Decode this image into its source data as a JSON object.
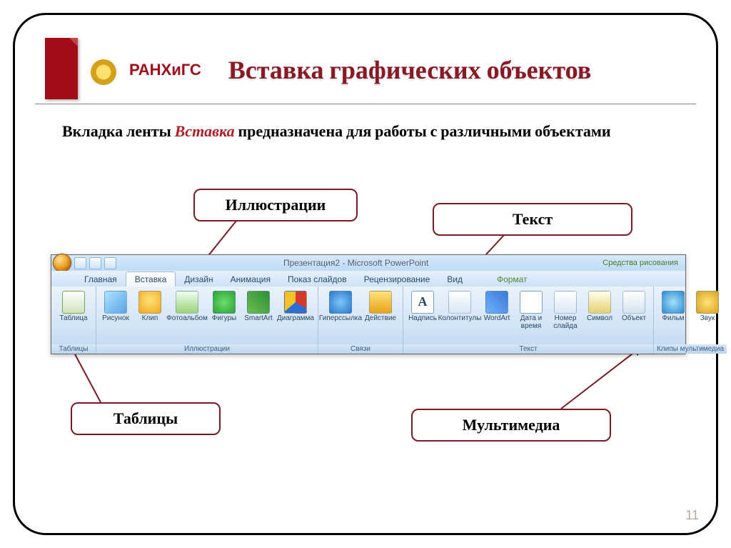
{
  "header": {
    "logo_main": "РАНХиГС",
    "title": "Вставка графических объектов"
  },
  "desc": {
    "prefix": "Вкладка ленты ",
    "em": "Вставка",
    "suffix": " предназначена для работы  с различными объектами"
  },
  "callouts": {
    "illustrations": "Иллюстрации",
    "text": "Текст",
    "tables": "Таблицы",
    "multimedia": "Мультимедиа"
  },
  "ribbon": {
    "window_title": "Презентация2 - Microsoft PowerPoint",
    "contextual": "Средства рисования",
    "tabs": {
      "home": "Главная",
      "insert": "Вставка",
      "design": "Дизайн",
      "anim": "Анимация",
      "slideshow": "Показ слайдов",
      "review": "Рецензирование",
      "view": "Вид",
      "format": "Формат"
    },
    "groups": {
      "tables": "Таблицы",
      "illustr": "Иллюстрации",
      "links": "Связи",
      "text": "Текст",
      "media": "Клипы мультимедиа"
    },
    "buttons": {
      "table": "Таблица",
      "picture": "Рисунок",
      "clip": "Клип",
      "album": "Фотоальбом",
      "shapes": "Фигуры",
      "smartart": "SmartArt",
      "chart": "Диаграмма",
      "hyperlink": "Гиперссылка",
      "action": "Действие",
      "textbox": "Надпись",
      "headerfooter": "Колонтитулы",
      "wordart": "WordArt",
      "datetime": "Дата и время",
      "slidenum": "Номер слайда",
      "symbol": "Символ",
      "object": "Объект",
      "movie": "Фильм",
      "sound": "Звук",
      "A": "A"
    }
  },
  "page_number": "11"
}
